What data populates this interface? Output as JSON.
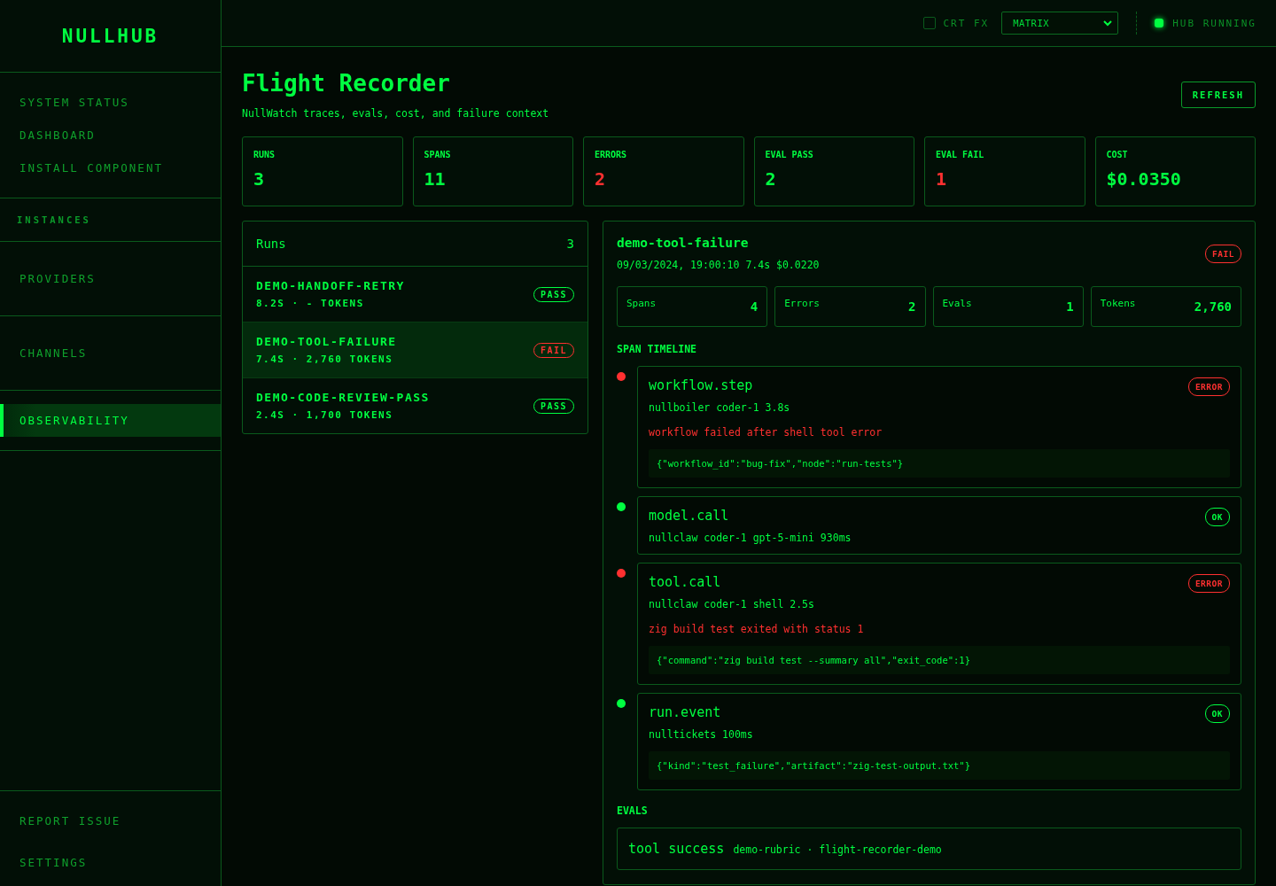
{
  "sidebar": {
    "logo": "NULLHUB",
    "sections": [
      {
        "items": [
          {
            "label": "SYSTEM STATUS",
            "kind": "link",
            "selected": false
          },
          {
            "label": "DASHBOARD",
            "kind": "link",
            "selected": false
          },
          {
            "label": "INSTALL COMPONENT",
            "kind": "link",
            "selected": false
          }
        ]
      },
      {
        "items": [
          {
            "label": "INSTANCES",
            "kind": "header"
          }
        ]
      },
      {
        "items": [
          {
            "label": "PROVIDERS",
            "kind": "link",
            "selected": false
          }
        ]
      },
      {
        "items": [
          {
            "label": "CHANNELS",
            "kind": "link",
            "selected": false
          }
        ]
      },
      {
        "items": [
          {
            "label": "OBSERVABILITY",
            "kind": "link",
            "selected": true
          }
        ]
      }
    ],
    "footer": [
      {
        "label": "REPORT ISSUE"
      },
      {
        "label": "SETTINGS"
      }
    ]
  },
  "topbar": {
    "crt": {
      "label": "CRT FX",
      "checked": false
    },
    "theme": "MATRIX",
    "hub_status": {
      "label": "HUB RUNNING",
      "on": true
    }
  },
  "page": {
    "title": "Flight Recorder",
    "subtitle": "NullWatch traces, evals, cost, and failure context",
    "refresh": "REFRESH"
  },
  "stats": [
    {
      "label": "RUNS",
      "value": "3",
      "kind": "ok"
    },
    {
      "label": "SPANS",
      "value": "11",
      "kind": "ok"
    },
    {
      "label": "ERRORS",
      "value": "2",
      "kind": "bad"
    },
    {
      "label": "EVAL PASS",
      "value": "2",
      "kind": "ok"
    },
    {
      "label": "EVAL FAIL",
      "value": "1",
      "kind": "bad"
    },
    {
      "label": "COST",
      "value": "$0.0350",
      "kind": "ok"
    }
  ],
  "runs": {
    "title": "Runs",
    "count": "3",
    "items": [
      {
        "name": "DEMO-HANDOFF-RETRY",
        "meta": "8.2S · - TOKENS",
        "status": "PASS",
        "kind": "pass",
        "selected": false
      },
      {
        "name": "DEMO-TOOL-FAILURE",
        "meta": "7.4S · 2,760 TOKENS",
        "status": "FAIL",
        "kind": "fail",
        "selected": true
      },
      {
        "name": "DEMO-CODE-REVIEW-PASS",
        "meta": "2.4S · 1,700 TOKENS",
        "status": "PASS",
        "kind": "pass",
        "selected": false
      }
    ]
  },
  "detail": {
    "title": "demo-tool-failure",
    "meta": "09/03/2024, 19:00:10 7.4s $0.0220",
    "status": "FAIL",
    "kind": "fail",
    "metrics": [
      {
        "label": "Spans",
        "value": "4"
      },
      {
        "label": "Errors",
        "value": "2"
      },
      {
        "label": "Evals",
        "value": "1"
      },
      {
        "label": "Tokens",
        "value": "2,760"
      }
    ],
    "timeline_title": "SPAN TIMELINE",
    "spans": [
      {
        "name": "workflow.step",
        "meta": "nullboiler coder-1 3.8s",
        "status": "ERROR",
        "kind": "error",
        "error": "workflow failed after shell tool error",
        "payload": "{\"workflow_id\":\"bug-fix\",\"node\":\"run-tests\"}"
      },
      {
        "name": "model.call",
        "meta": "nullclaw coder-1 gpt-5-mini 930ms",
        "status": "OK",
        "kind": "ok"
      },
      {
        "name": "tool.call",
        "meta": "nullclaw coder-1 shell 2.5s",
        "status": "ERROR",
        "kind": "error",
        "error": "zig build test exited with status 1",
        "payload": "{\"command\":\"zig build test --summary all\",\"exit_code\":1}"
      },
      {
        "name": "run.event",
        "meta": "nulltickets 100ms",
        "status": "OK",
        "kind": "ok",
        "payload": "{\"kind\":\"test_failure\",\"artifact\":\"zig-test-output.txt\"}"
      }
    ],
    "evals_title": "EVALS",
    "evals": [
      {
        "name": "tool success",
        "meta": "demo-rubric · flight-recorder-demo"
      }
    ]
  }
}
